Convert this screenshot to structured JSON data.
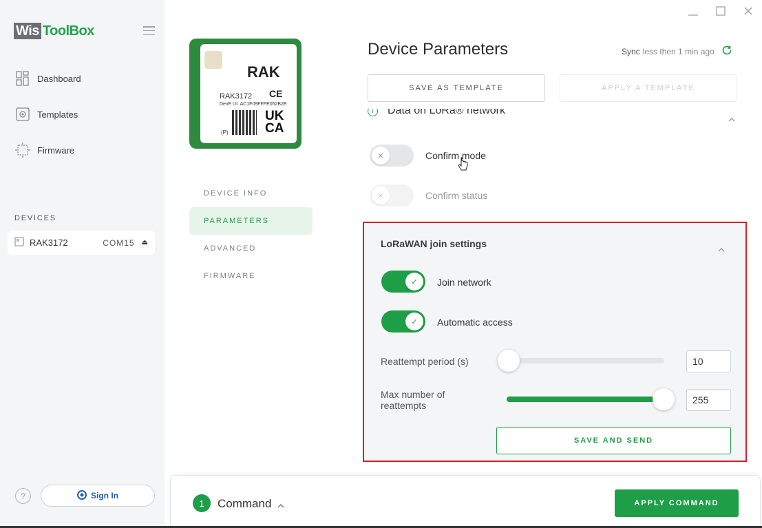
{
  "app": {
    "logo_wis": "Wis",
    "logo_toolbox": "ToolBox"
  },
  "sidebar": {
    "items": [
      {
        "label": "Dashboard",
        "icon": "dashboard-icon"
      },
      {
        "label": "Templates",
        "icon": "templates-icon"
      },
      {
        "label": "Firmware",
        "icon": "chip-icon"
      }
    ],
    "devices_title": "DEVICES",
    "device": {
      "name": "RAK3172",
      "port": "COM15",
      "eject": "⏏"
    },
    "help": "?",
    "signin": "Sign In"
  },
  "device_image": {
    "brand": "RAK",
    "model": "RAK3172",
    "ce": "CE",
    "deveui": "DevE UI: AC1F09FFFE052B2E",
    "ukca": "UK\nCA",
    "p": "(P)"
  },
  "tabs": [
    {
      "label": "DEVICE INFO",
      "active": false
    },
    {
      "label": "PARAMETERS",
      "active": true
    },
    {
      "label": "ADVANCED",
      "active": false
    },
    {
      "label": "FIRMWARE",
      "active": false
    }
  ],
  "main": {
    "title": "Device Parameters",
    "sync_prefix": "Sync",
    "sync_text": "less then 1 min ago",
    "save_template": "SAVE AS TEMPLATE",
    "apply_template": "APPLY A TEMPLATE",
    "section_header": "Data on LoRa® network",
    "confirm_mode": {
      "label": "Confirm mode",
      "on": false
    },
    "confirm_status": {
      "label": "Confirm status",
      "on": false
    }
  },
  "join_settings": {
    "title": "LoRaWAN join settings",
    "join_network": {
      "label": "Join network",
      "on": true
    },
    "automatic_access": {
      "label": "Automatic access",
      "on": true
    },
    "reattempt_period": {
      "label": "Reattempt period (s)",
      "value": "10",
      "fraction": 0.0
    },
    "max_reattempts": {
      "label_line1": "Max number of",
      "label_line2": "reattempts",
      "value": "255",
      "fraction": 1.0
    },
    "save_send": "SAVE AND SEND"
  },
  "bottom": {
    "cmd_count": "1",
    "cmd_label": "Command",
    "apply": "APPLY COMMAND"
  },
  "colors": {
    "accent": "#1e9e46",
    "highlight": "#d32028",
    "brand_blue": "#1f5fb8"
  }
}
